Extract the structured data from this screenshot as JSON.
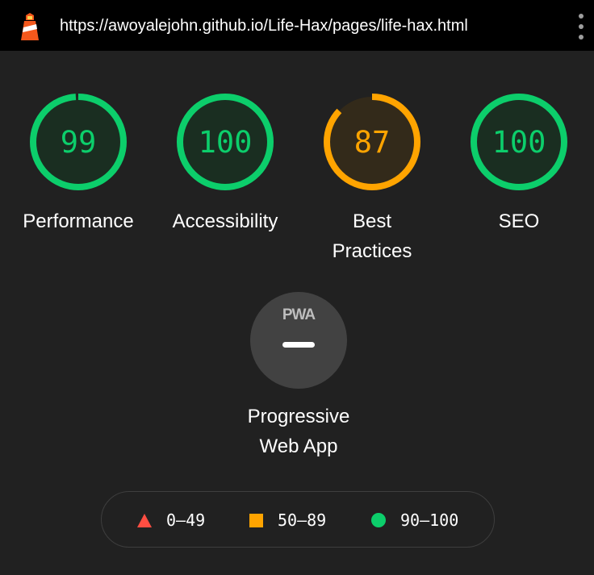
{
  "topbar": {
    "url": "https://awoyalejohn.github.io/Life-Hax/pages/life-hax.html",
    "logo_icon": "lighthouse-icon",
    "menu_icon": "more-vertical-icon"
  },
  "colors": {
    "pass": "#0cce6b",
    "average": "#ffa400",
    "fail": "#ff4e42",
    "pass_bg": "#1a2e21",
    "average_bg": "#332a1a",
    "neutral_bg": "#424242"
  },
  "gauges": [
    {
      "score": "99",
      "fraction": 0.99,
      "label": "Performance",
      "rating": "pass"
    },
    {
      "score": "100",
      "fraction": 1.0,
      "label": "Accessibility",
      "rating": "pass"
    },
    {
      "score": "87",
      "fraction": 0.87,
      "label_line1": "Best",
      "label_line2": "Practices",
      "rating": "average"
    },
    {
      "score": "100",
      "fraction": 1.0,
      "label": "SEO",
      "rating": "pass"
    }
  ],
  "pwa": {
    "badge_text": "PWA",
    "label_line1": "Progressive",
    "label_line2": "Web App",
    "icon": "pwa-badge-icon"
  },
  "legend": [
    {
      "range": "0–49",
      "shape": "triangle-icon"
    },
    {
      "range": "50–89",
      "shape": "square-icon"
    },
    {
      "range": "90–100",
      "shape": "circle-icon"
    }
  ]
}
